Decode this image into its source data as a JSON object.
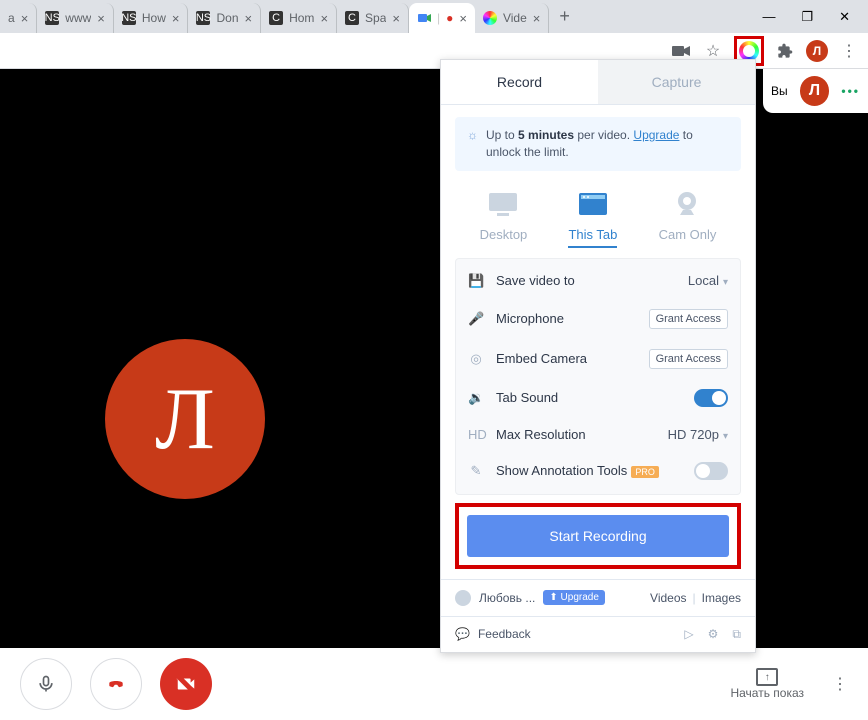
{
  "browser_tabs": [
    {
      "title": "a"
    },
    {
      "title": "www"
    },
    {
      "title": "How"
    },
    {
      "title": "Don"
    },
    {
      "title": "Hom"
    },
    {
      "title": "Spa"
    },
    {
      "title": "",
      "active": true
    },
    {
      "title": "Vide"
    }
  ],
  "window_controls": {
    "minimize": "—",
    "maximize": "❐",
    "close": "✕"
  },
  "toolbar": {
    "avatar_letter": "Л"
  },
  "user_ribbon": {
    "label": "Вы",
    "avatar_letter": "Л"
  },
  "meeting": {
    "avatar_letter": "Л"
  },
  "bottombar": {
    "present_label": "Начать показ"
  },
  "popup": {
    "tabs": {
      "record": "Record",
      "capture": "Capture"
    },
    "banner": {
      "pre": "Up to ",
      "bold": "5 minutes",
      "mid": " per video. ",
      "link": "Upgrade",
      "post": " to unlock the limit."
    },
    "modes": {
      "desktop": "Desktop",
      "this_tab": "This Tab",
      "cam_only": "Cam Only"
    },
    "settings": {
      "save_label": "Save video to",
      "save_value": "Local",
      "mic_label": "Microphone",
      "mic_value": "Grant Access",
      "cam_label": "Embed Camera",
      "cam_value": "Grant Access",
      "tabsound_label": "Tab Sound",
      "res_label": "Max Resolution",
      "res_value": "HD 720p",
      "anno_label": "Show Annotation Tools",
      "anno_badge": "PRO"
    },
    "start_label": "Start Recording",
    "footer": {
      "user": "Любовь ...",
      "upgrade": "⬆ Upgrade",
      "videos": "Videos",
      "images": "Images",
      "feedback": "Feedback"
    }
  }
}
